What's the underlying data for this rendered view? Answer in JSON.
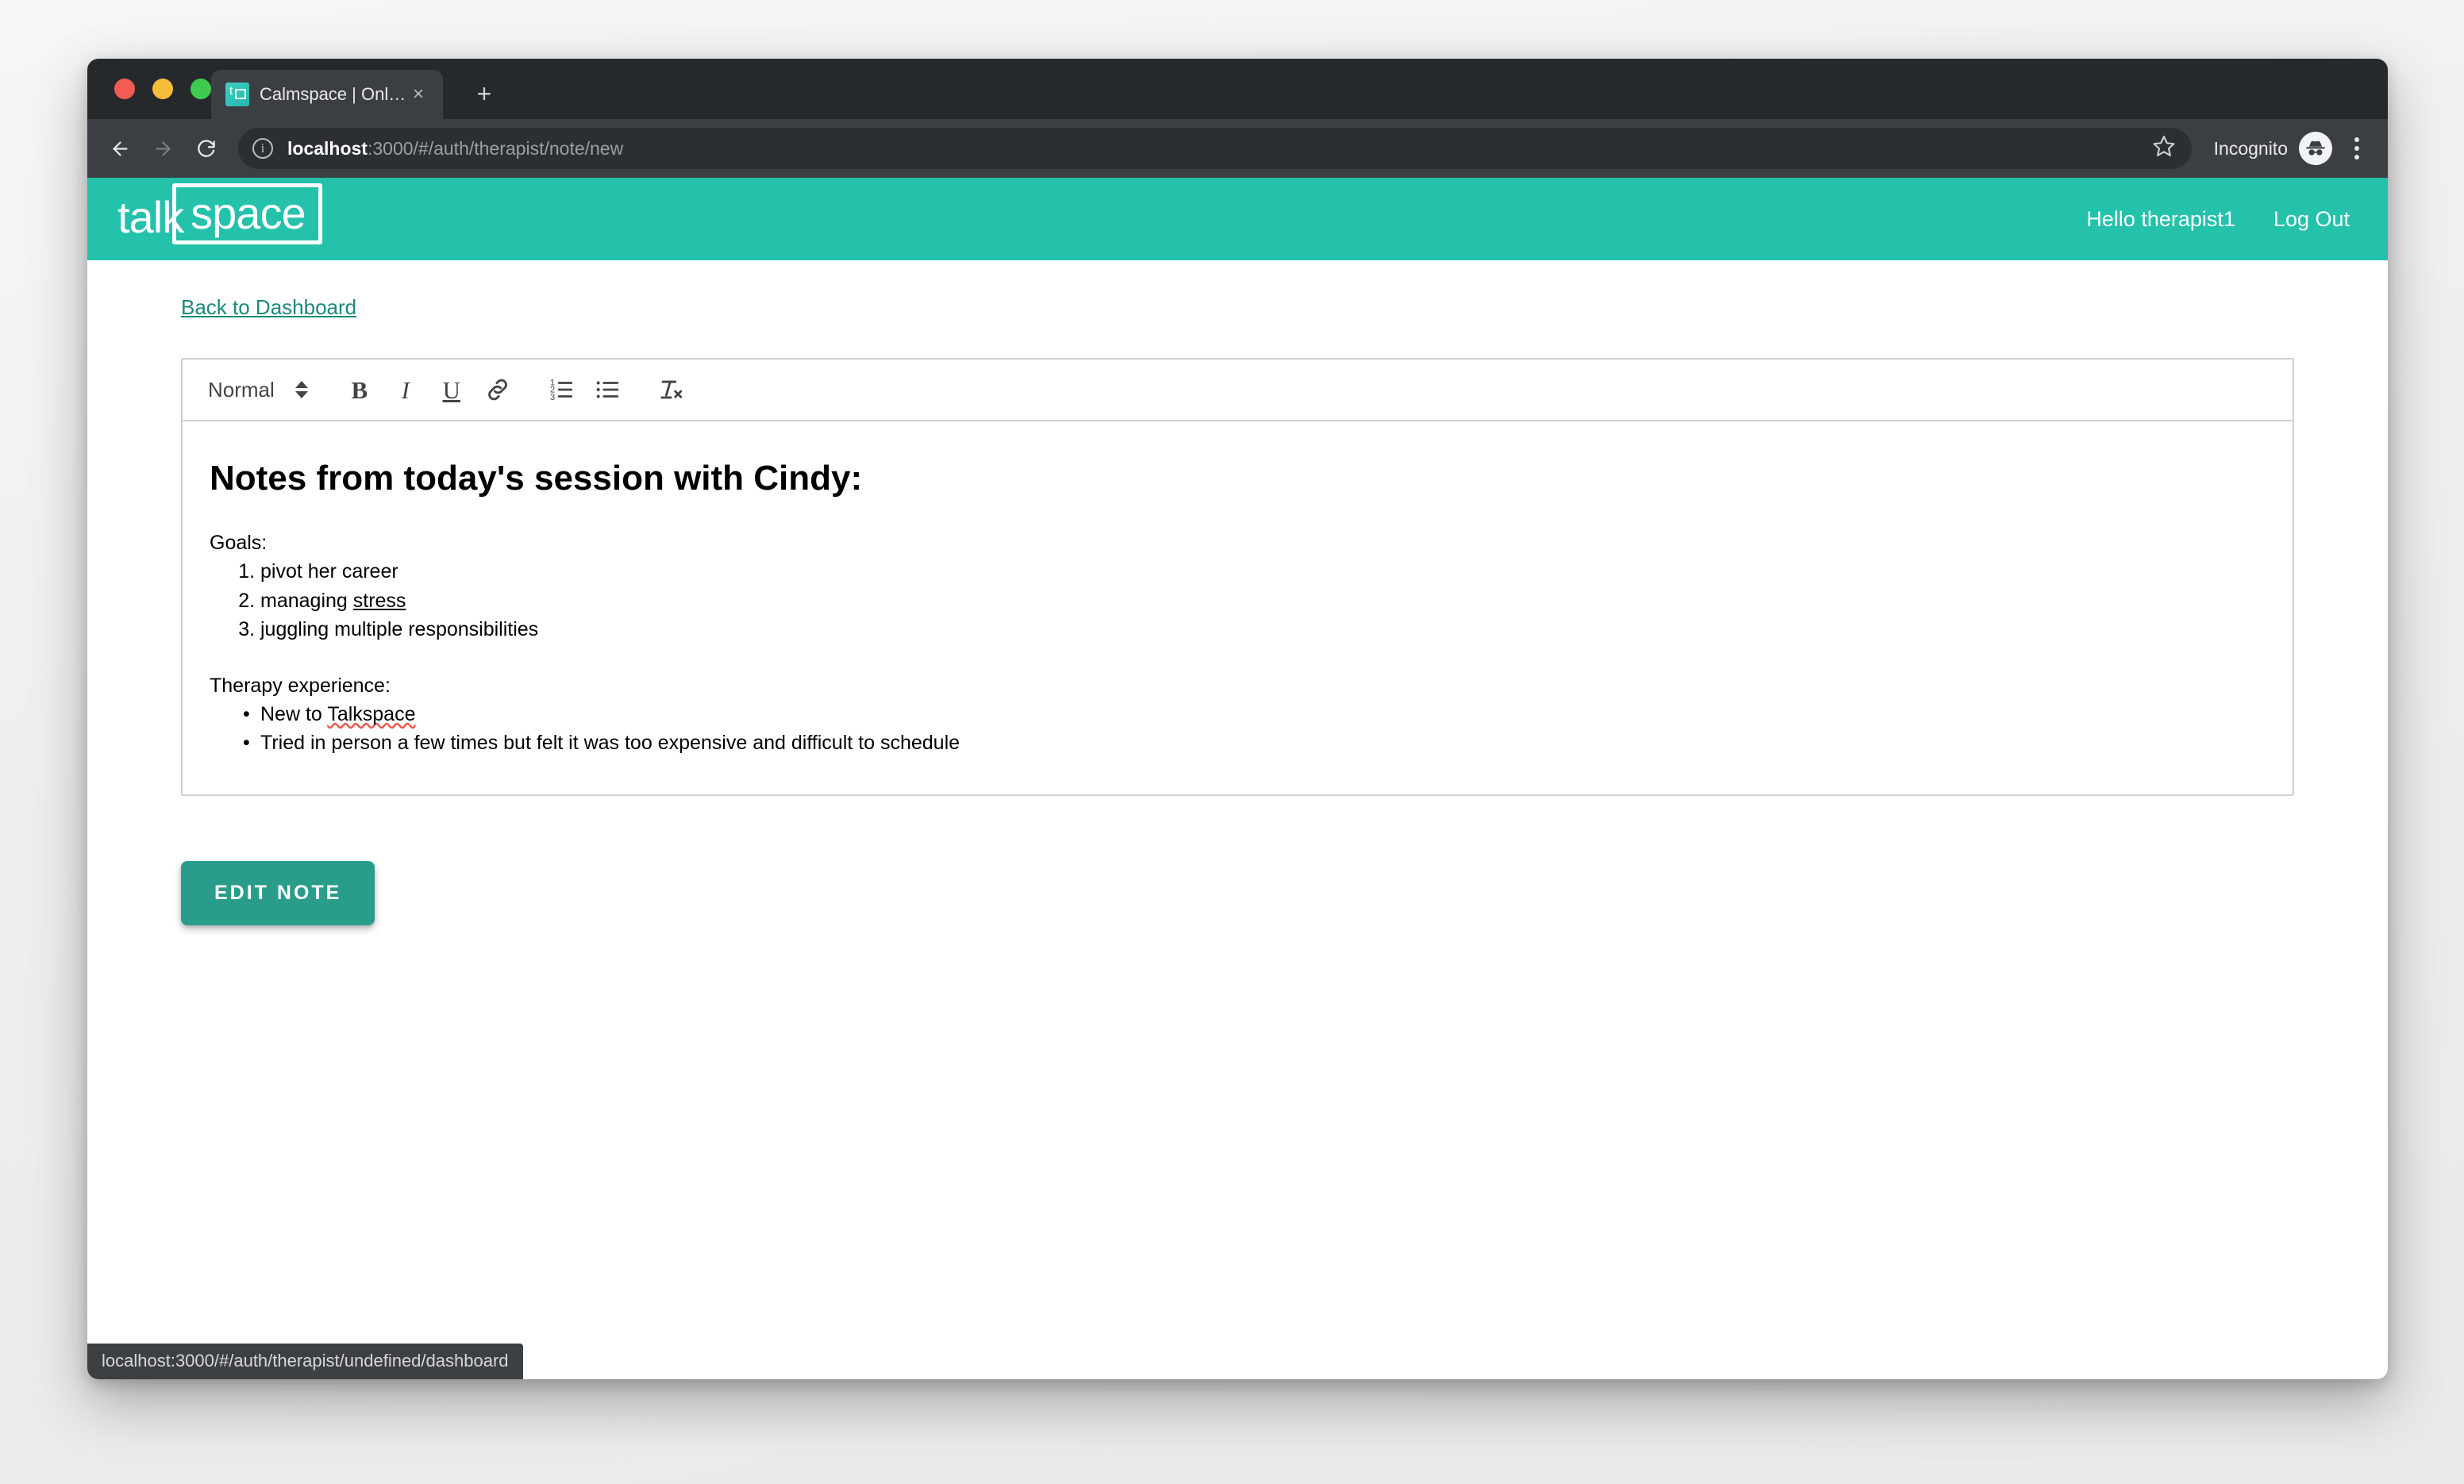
{
  "browser": {
    "tab": {
      "title": "Calmspace | Online Therapy",
      "favicon_name": "talkspace-favicon",
      "favicon_letter": "t",
      "close_label": "×"
    },
    "new_tab_label": "+",
    "nav": {
      "back_name": "back-icon",
      "forward_name": "forward-icon",
      "reload_name": "reload-icon"
    },
    "omnibox": {
      "info_label": "i",
      "url_host": "localhost",
      "url_rest": ":3000/#/auth/therapist/note/new",
      "star_name": "bookmark-star-icon"
    },
    "incognito_label": "Incognito",
    "menu_name": "browser-menu-icon"
  },
  "app": {
    "logo": {
      "part1": "talk",
      "part2": "space"
    },
    "greeting": "Hello therapist1",
    "logout": "Log Out",
    "brand_color": "#24c1ab",
    "accent_color": "#2a9d8a"
  },
  "page": {
    "back_link": "Back to Dashboard",
    "edit_button": "EDIT NOTE",
    "status_url": "localhost:3000/#/auth/therapist/undefined/dashboard"
  },
  "editor": {
    "toolbar": {
      "format_label": "Normal",
      "bold_label": "B",
      "italic_label": "I",
      "underline_label": "U",
      "link_name": "link-icon",
      "ordered_list_name": "ordered-list-icon",
      "bullet_list_name": "bullet-list-icon",
      "clear_format_label": "T"
    },
    "note": {
      "title": "Notes from today's session with Cindy:",
      "goals_heading": "Goals:",
      "goals": [
        {
          "text": "pivot her career",
          "underlined": ""
        },
        {
          "text": "managing ",
          "underlined": "stress"
        },
        {
          "text": "juggling multiple responsibilities",
          "underlined": ""
        }
      ],
      "experience_heading": "Therapy experience:",
      "experience": [
        {
          "pre": "New to ",
          "misspelled": "Talkspace",
          "post": ""
        },
        {
          "pre": "Tried in person a few times but felt it was too expensive and difficult to schedule",
          "misspelled": "",
          "post": ""
        }
      ]
    }
  }
}
